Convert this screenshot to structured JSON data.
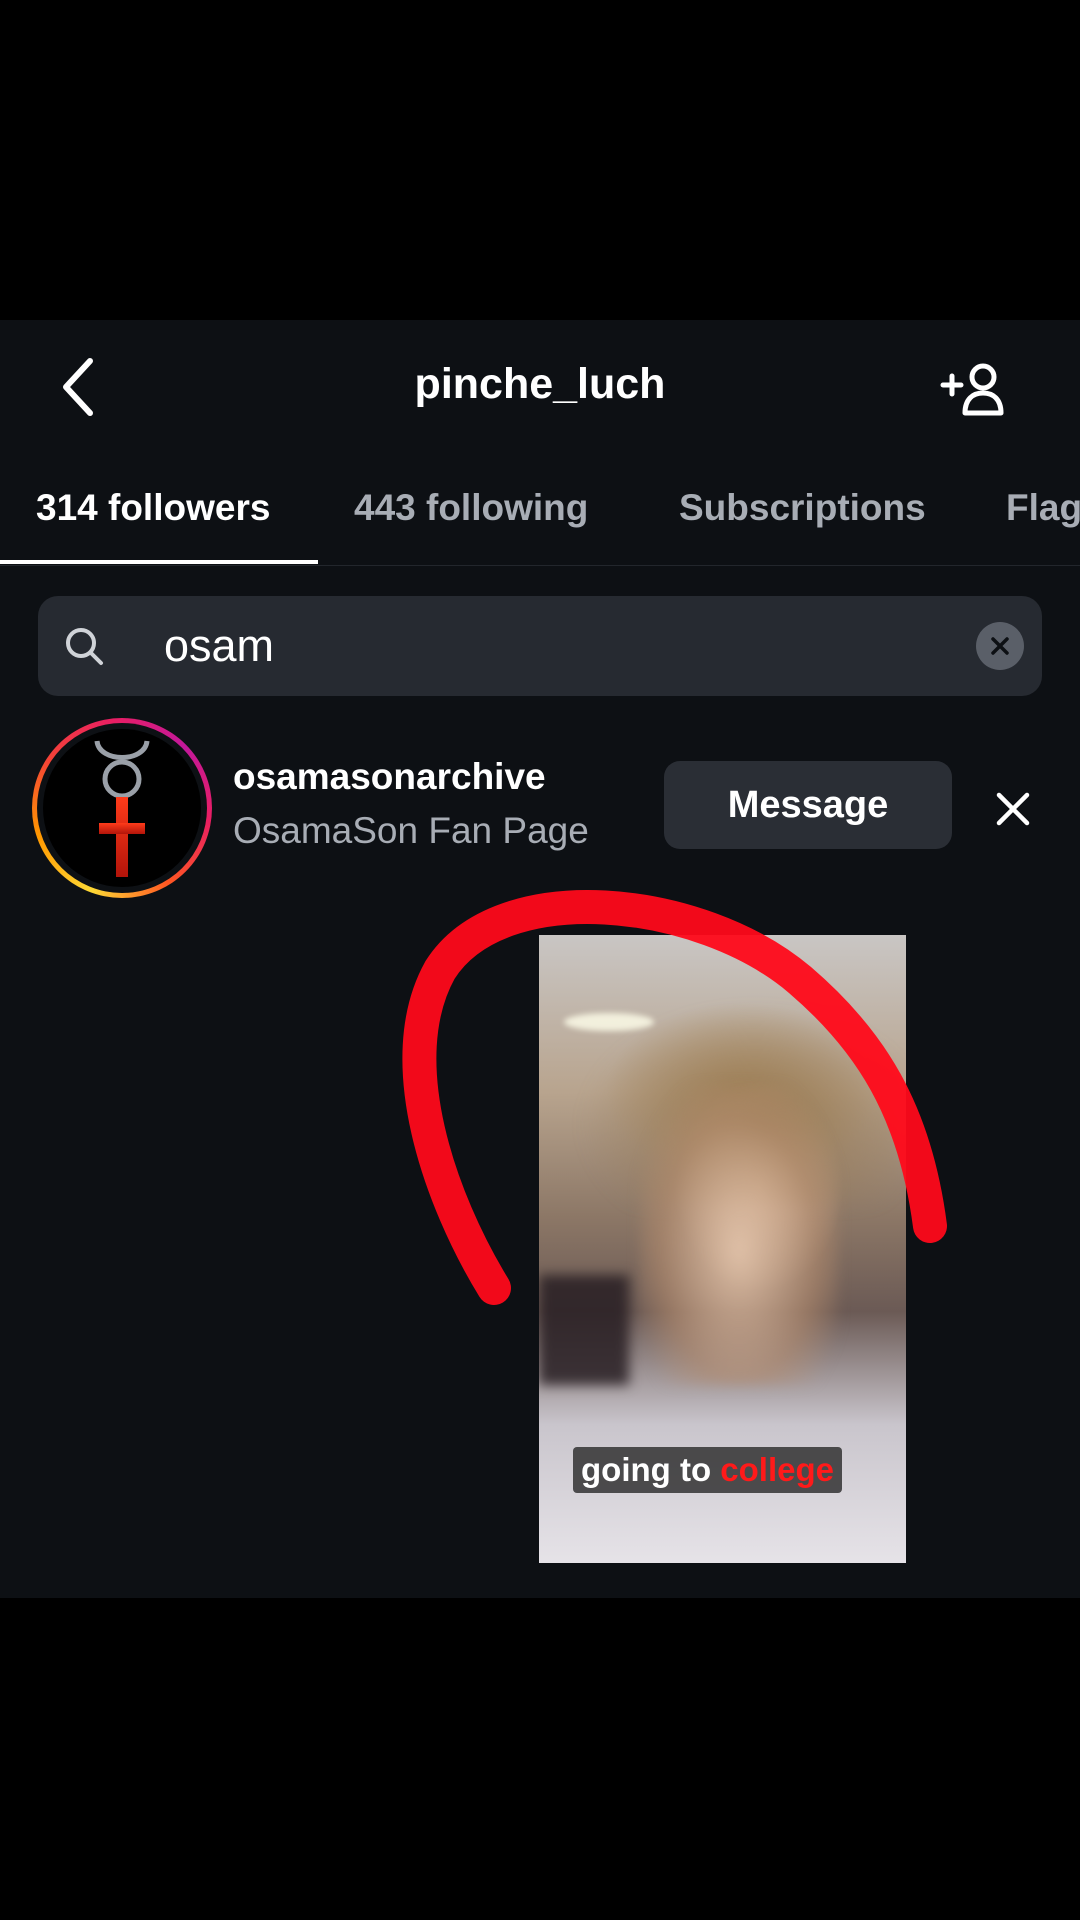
{
  "header": {
    "title": "pinche_luch",
    "back_icon": "chevron-left-icon",
    "add_user_icon": "add-person-icon"
  },
  "tabs": [
    {
      "label": "314 followers",
      "active": true
    },
    {
      "label": "443 following",
      "active": false
    },
    {
      "label": "Subscriptions",
      "active": false
    },
    {
      "label": "Flag",
      "active": false
    }
  ],
  "search": {
    "value": "osam",
    "icon": "search-icon",
    "clear_icon": "clear-icon"
  },
  "results": [
    {
      "username": "osamasonarchive",
      "full_name": "OsamaSon Fan Page",
      "message_label": "Message",
      "remove_icon": "close-icon"
    }
  ],
  "overlay": {
    "caption_part1": "going to ",
    "caption_part2": "college",
    "caption_highlight_color": "#ff1a1a",
    "annotation_color": "#ff0a1a"
  },
  "colors": {
    "background": "#0d1014",
    "letterbox": "#000000",
    "button": "#2a2e35",
    "search_field": "#262a31",
    "secondary_text": "#a8adb5"
  }
}
